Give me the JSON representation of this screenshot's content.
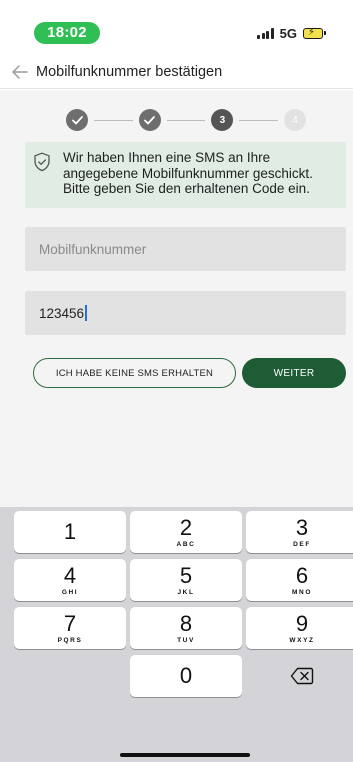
{
  "status_bar": {
    "time": "18:02",
    "network": "5G"
  },
  "header": {
    "title": "Mobilfunknummer bestätigen"
  },
  "stepper": {
    "steps": [
      {
        "state": "done",
        "label": ""
      },
      {
        "state": "done",
        "label": ""
      },
      {
        "state": "current",
        "label": "3"
      },
      {
        "state": "todo",
        "label": "4"
      }
    ]
  },
  "info": {
    "text_line1": "Wir haben Ihnen eine SMS an Ihre",
    "text_line2": "angegebene Mobilfunknummer geschickt.",
    "text_line3": "Bitte geben Sie den erhaltenen Code ein."
  },
  "form": {
    "phone_placeholder": "Mobilfunknummer",
    "code_value": "123456"
  },
  "buttons": {
    "no_sms": "ICH HABE KEINE SMS ERHALTEN",
    "next": "WEITER"
  },
  "keypad": {
    "keys": [
      {
        "digit": "1",
        "letters": ""
      },
      {
        "digit": "2",
        "letters": "ABC"
      },
      {
        "digit": "3",
        "letters": "DEF"
      },
      {
        "digit": "4",
        "letters": "GHI"
      },
      {
        "digit": "5",
        "letters": "JKL"
      },
      {
        "digit": "6",
        "letters": "MNO"
      },
      {
        "digit": "7",
        "letters": "PQRS"
      },
      {
        "digit": "8",
        "letters": "TUV"
      },
      {
        "digit": "9",
        "letters": "WXYZ"
      },
      {
        "digit": "0",
        "letters": ""
      }
    ]
  },
  "colors": {
    "accent_green": "#1d5c35",
    "time_pill": "#2fbf54",
    "info_bg": "#e1ece3"
  },
  "icons": {
    "back": "arrow-left-icon",
    "info": "shield-check-icon",
    "delete": "backspace-icon"
  }
}
